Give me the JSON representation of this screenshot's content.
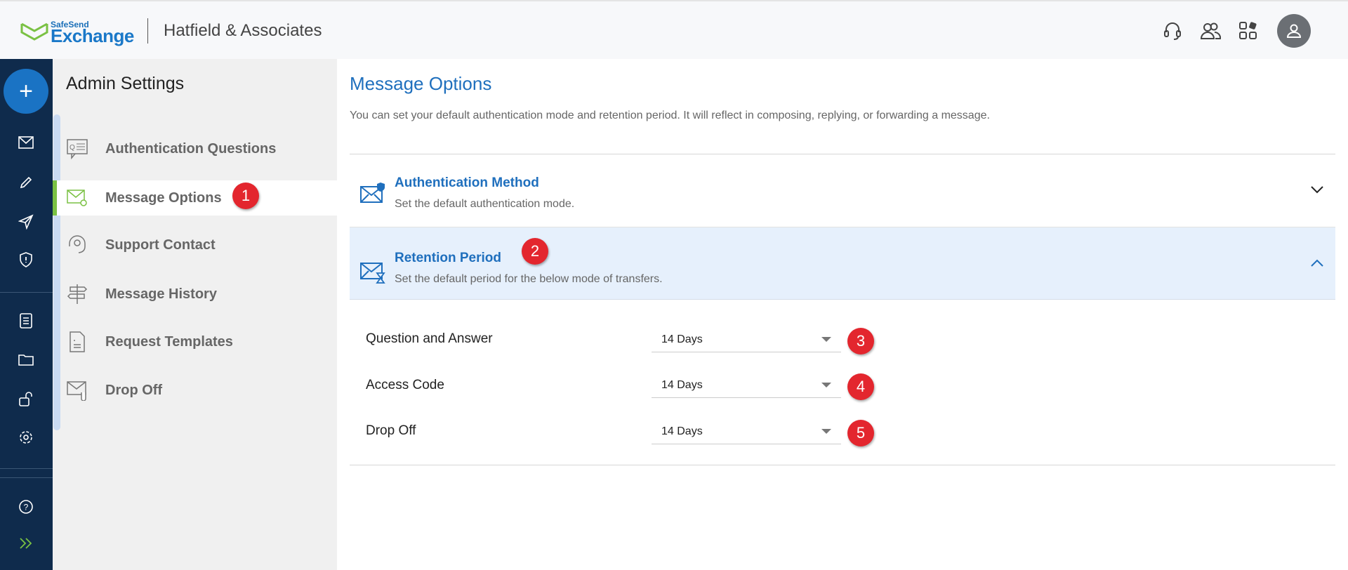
{
  "header": {
    "logo_top": "SafeSend",
    "logo_main": "Exchange",
    "company": "Hatfield & Associates",
    "icons": [
      "headset-icon",
      "users-icon",
      "apps-icon",
      "avatar-icon"
    ]
  },
  "rail": {
    "compose": "+"
  },
  "sidebar": {
    "title": "Admin Settings",
    "items": [
      {
        "label": "Authentication Questions"
      },
      {
        "label": "Message Options"
      },
      {
        "label": "Support Contact"
      },
      {
        "label": "Message History"
      },
      {
        "label": "Request Templates"
      },
      {
        "label": "Drop Off"
      }
    ]
  },
  "main": {
    "title": "Message Options",
    "description": "You can set your default authentication mode and retention period. It will reflect in composing, replying, or forwarding a message.",
    "sections": [
      {
        "title": "Authentication Method",
        "subtitle": "Set the default authentication mode."
      },
      {
        "title": "Retention Period",
        "subtitle": "Set the default period for the below mode of transfers."
      }
    ],
    "rows": [
      {
        "label": "Question and Answer",
        "value": "14 Days"
      },
      {
        "label": "Access Code",
        "value": "14 Days"
      },
      {
        "label": "Drop Off",
        "value": "14 Days"
      }
    ]
  },
  "badges": [
    "1",
    "2",
    "3",
    "4",
    "5"
  ],
  "colors": {
    "accent": "#1f6fbd",
    "rail": "#0f2b4c",
    "active": "#7ac143",
    "badge": "#e3262e",
    "section_bg": "#e6f0fc"
  }
}
